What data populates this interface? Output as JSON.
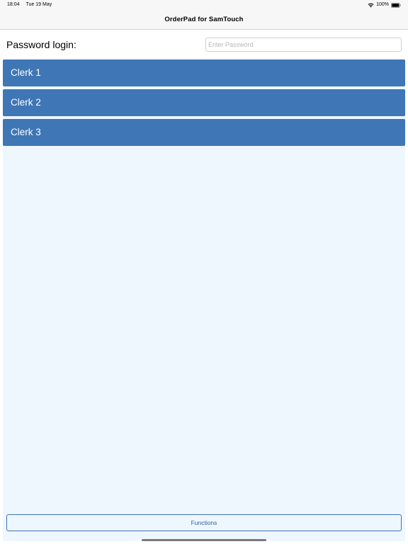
{
  "status_bar": {
    "time": "18:04",
    "date": "Tue 19 May",
    "battery_percent": "100%",
    "battery_level": 1.0
  },
  "nav": {
    "title": "OrderPad for SamTouch"
  },
  "login": {
    "label": "Password login:",
    "password_placeholder": "Enter Password",
    "password_value": ""
  },
  "clerks": [
    {
      "label": "Clerk 1"
    },
    {
      "label": "Clerk 2"
    },
    {
      "label": "Clerk 3"
    }
  ],
  "footer": {
    "functions_label": "Functions"
  },
  "colors": {
    "accent": "#3f76b6",
    "list_background": "#eef6fe",
    "bar_background": "#f7f7f7"
  }
}
